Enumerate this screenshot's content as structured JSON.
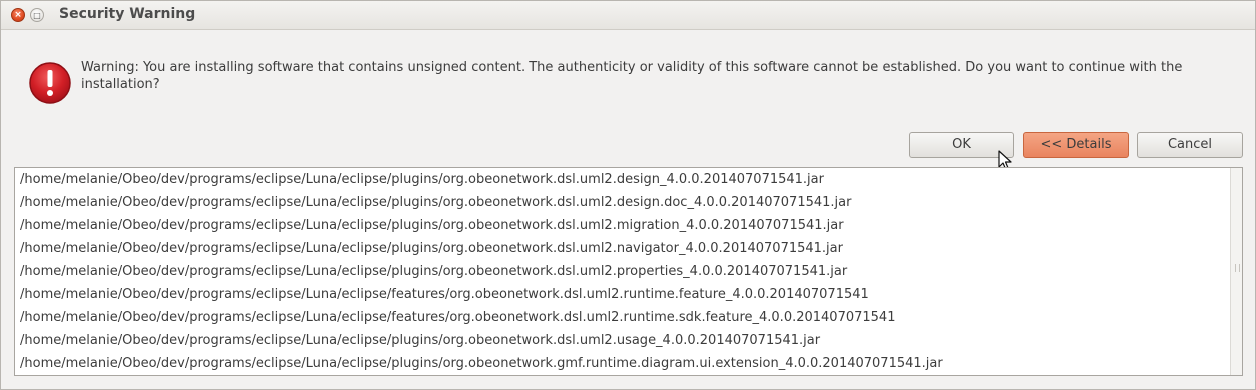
{
  "window": {
    "title": "Security Warning",
    "close_glyph": "×",
    "max_glyph": "□"
  },
  "message": {
    "icon": "error-icon",
    "text": "Warning: You are installing software that contains unsigned content. The authenticity or validity of this software cannot be established. Do you want to continue with the installation?"
  },
  "buttons": {
    "ok": "OK",
    "details": "<< Details",
    "cancel": "Cancel"
  },
  "files": [
    "/home/melanie/Obeo/dev/programs/eclipse/Luna/eclipse/plugins/org.obeonetwork.dsl.uml2.design_4.0.0.201407071541.jar",
    "/home/melanie/Obeo/dev/programs/eclipse/Luna/eclipse/plugins/org.obeonetwork.dsl.uml2.design.doc_4.0.0.201407071541.jar",
    "/home/melanie/Obeo/dev/programs/eclipse/Luna/eclipse/plugins/org.obeonetwork.dsl.uml2.migration_4.0.0.201407071541.jar",
    "/home/melanie/Obeo/dev/programs/eclipse/Luna/eclipse/plugins/org.obeonetwork.dsl.uml2.navigator_4.0.0.201407071541.jar",
    "/home/melanie/Obeo/dev/programs/eclipse/Luna/eclipse/plugins/org.obeonetwork.dsl.uml2.properties_4.0.0.201407071541.jar",
    "/home/melanie/Obeo/dev/programs/eclipse/Luna/eclipse/features/org.obeonetwork.dsl.uml2.runtime.feature_4.0.0.201407071541",
    "/home/melanie/Obeo/dev/programs/eclipse/Luna/eclipse/features/org.obeonetwork.dsl.uml2.runtime.sdk.feature_4.0.0.201407071541",
    "/home/melanie/Obeo/dev/programs/eclipse/Luna/eclipse/plugins/org.obeonetwork.dsl.uml2.usage_4.0.0.201407071541.jar",
    "/home/melanie/Obeo/dev/programs/eclipse/Luna/eclipse/plugins/org.obeonetwork.gmf.runtime.diagram.ui.extension_4.0.0.201407071541.jar"
  ],
  "colors": {
    "accent_button": "#e9845f",
    "error_icon": "#c7161e"
  }
}
